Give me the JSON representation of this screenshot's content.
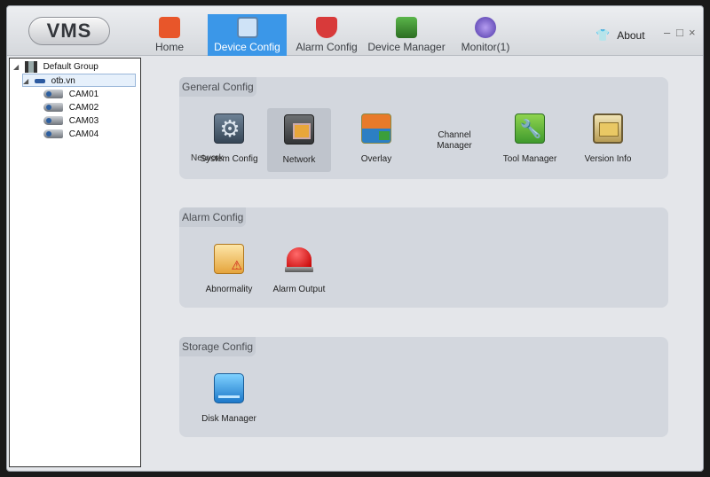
{
  "app": {
    "logo": "VMS"
  },
  "nav": {
    "tabs": [
      {
        "label": "Home",
        "icon": "home-icon",
        "color": "#e8562a"
      },
      {
        "label": "Device Config",
        "icon": "device-config-icon",
        "color": "#7ab0e8",
        "active": true
      },
      {
        "label": "Alarm Config",
        "icon": "alarm-config-icon",
        "color": "#d83a3a"
      },
      {
        "label": "Device Manager",
        "icon": "device-manager-icon",
        "color": "#4a9a3a"
      },
      {
        "label": "Monitor(1)",
        "icon": "monitor-icon",
        "color": "#7a5ec8"
      }
    ],
    "about": "About",
    "window_controls": {
      "minimize": "–",
      "maximize": "□",
      "close": "×"
    }
  },
  "tree": {
    "group": "Default Group",
    "device": "otb.vn",
    "cameras": [
      "CAM01",
      "CAM02",
      "CAM03",
      "CAM04"
    ]
  },
  "general_config": {
    "title": "General Config",
    "items": {
      "system": "System Config",
      "network": "Network",
      "overlay": "Overlay",
      "channel_line1": "Channel",
      "channel_line2": "Manager",
      "tool": "Tool Manager",
      "version": "Version Info"
    },
    "overlap_text": "Network"
  },
  "alarm_config": {
    "title": "Alarm Config",
    "items": {
      "abnormality": "Abnormality",
      "alarm_output": "Alarm Output"
    }
  },
  "storage_config": {
    "title": "Storage Config",
    "items": {
      "disk": "Disk Manager"
    }
  },
  "colors": {
    "accent": "#3b97e8",
    "panel": "#d3d7de"
  }
}
